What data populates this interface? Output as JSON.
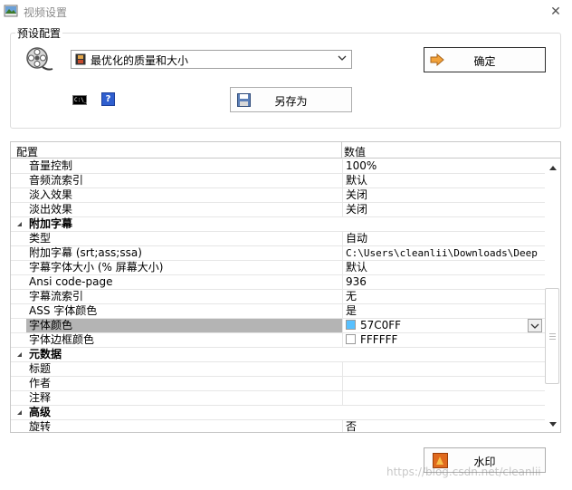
{
  "window": {
    "title": "视频设置",
    "close_glyph": "✕"
  },
  "preset": {
    "group_label": "预设配置",
    "selected": "最优化的质量和大小",
    "ok_label": "确定",
    "save_as_label": "另存为",
    "cmd_icon_text": "C:\\_",
    "help_icon_text": "?"
  },
  "grid": {
    "col_name": "配置",
    "col_value": "数值",
    "rows": [
      {
        "name": "音量控制",
        "value": "100%"
      },
      {
        "name": "音频流索引",
        "value": "默认"
      },
      {
        "name": "淡入效果",
        "value": "关闭"
      },
      {
        "name": "淡出效果",
        "value": "关闭"
      },
      {
        "name": "附加字幕",
        "category": true
      },
      {
        "name": "类型",
        "value": "自动"
      },
      {
        "name": "附加字幕 (srt;ass;ssa)",
        "value": "C:\\Users\\cleanlii\\Downloads\\Deep ..."
      },
      {
        "name": "字幕字体大小 (% 屏幕大小)",
        "value": "默认"
      },
      {
        "name": "Ansi code-page",
        "value": "936"
      },
      {
        "name": "字幕流索引",
        "value": "无"
      },
      {
        "name": "ASS 字体颜色",
        "value": "是"
      },
      {
        "name": "字体颜色",
        "value": "57C0FF",
        "swatch": "#57c0ff",
        "selected": true
      },
      {
        "name": "字体边框颜色",
        "value": "FFFFFF",
        "swatch": "#ffffff"
      },
      {
        "name": "元数据",
        "category": true
      },
      {
        "name": "标题",
        "value": ""
      },
      {
        "name": "作者",
        "value": ""
      },
      {
        "name": "注释",
        "value": ""
      },
      {
        "name": "高级",
        "category": true
      },
      {
        "name": "旋转",
        "value": "否"
      }
    ]
  },
  "footer": {
    "watermark_label": "水印",
    "overlay_text": "https://blog.csdn.net/cleanlii"
  },
  "colors": {
    "selection": "#b4b4b4",
    "accent_blue": "#2f5fcf",
    "ok_arrow": "#f2a23a"
  }
}
